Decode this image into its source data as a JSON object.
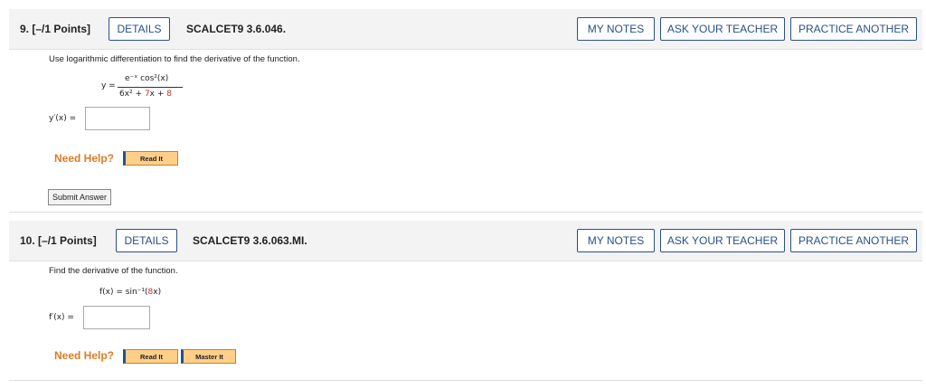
{
  "questions": [
    {
      "number": "9.",
      "points": "[–/1 Points]",
      "details_label": "DETAILS",
      "code": "SCALCET9 3.6.046.",
      "my_notes_label": "MY NOTES",
      "ask_teacher_label": "ASK YOUR TEACHER",
      "practice_label": "PRACTICE ANOTHER",
      "prompt": "Use logarithmic differentiation to find the derivative of the function.",
      "eq_lhs": "y =",
      "numerator": "e⁻ˣ cos²(x)",
      "denominator_a": "6x² + ",
      "denominator_b": "7",
      "denominator_c": "x + ",
      "denominator_d": "8",
      "answer_label": "y′(x) =",
      "need_help": "Need Help?",
      "read_it": "Read It",
      "submit": "Submit Answer"
    },
    {
      "number": "10.",
      "points": "[–/1 Points]",
      "details_label": "DETAILS",
      "code": "SCALCET9 3.6.063.MI.",
      "my_notes_label": "MY NOTES",
      "ask_teacher_label": "ASK YOUR TEACHER",
      "practice_label": "PRACTICE ANOTHER",
      "prompt": "Find the derivative of the function.",
      "func_a": "f(x) = sin⁻¹(",
      "func_b": "8",
      "func_c": "x)",
      "answer_label": "f′(x) =",
      "need_help": "Need Help?",
      "read_it": "Read It",
      "master_it": "Master It"
    }
  ]
}
